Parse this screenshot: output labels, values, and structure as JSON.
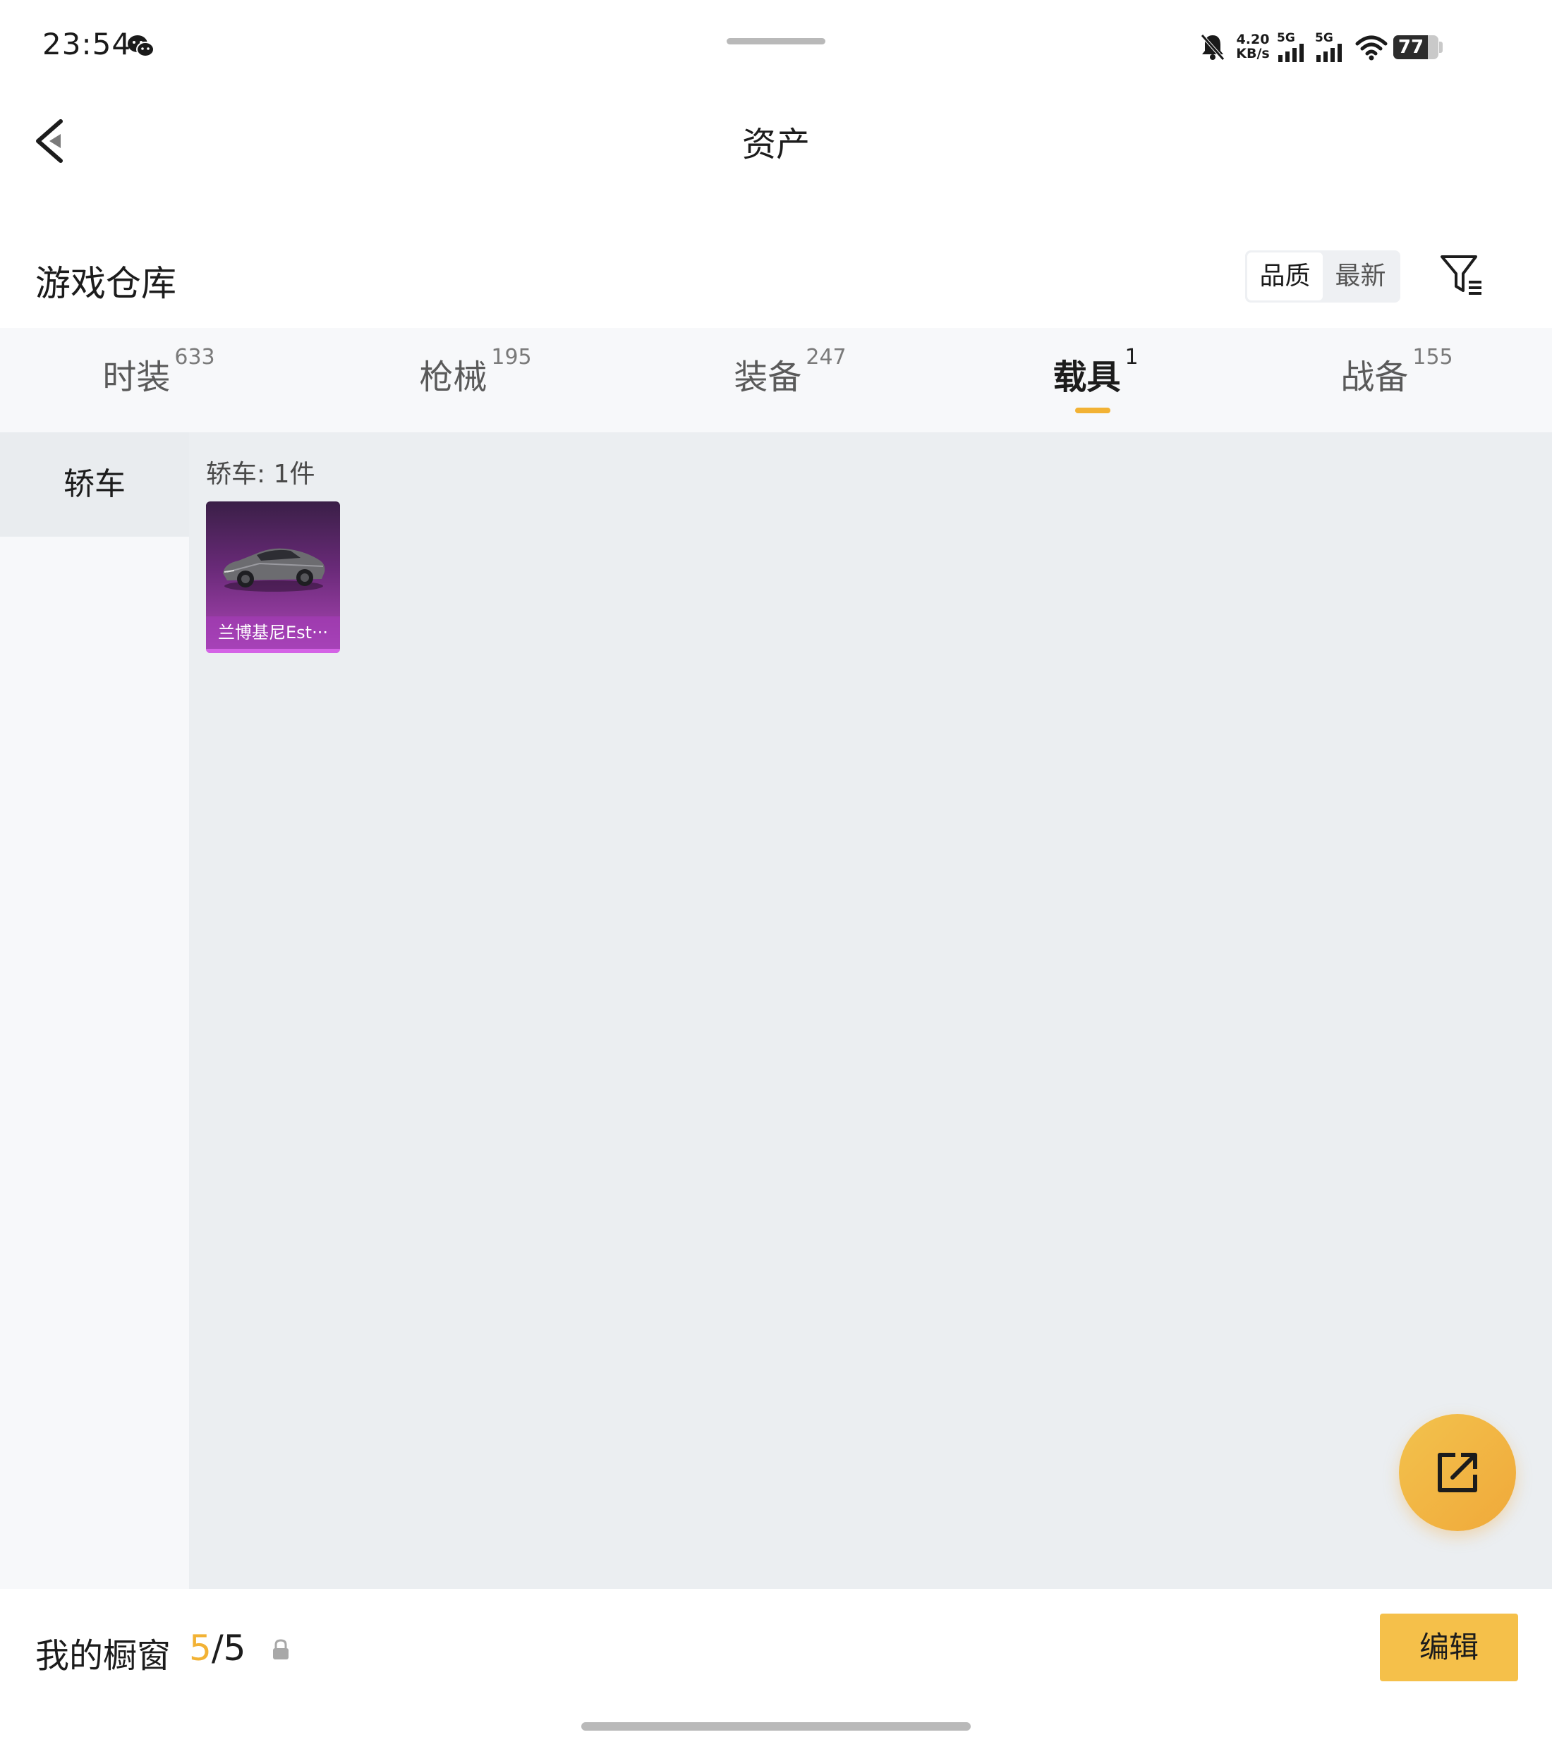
{
  "status_bar": {
    "time": "23:54",
    "net_speed_value": "4.20",
    "net_speed_unit": "KB/s",
    "signal1_label": "5G",
    "signal2_label": "5G",
    "battery_level": "77",
    "icons": [
      "wechat-icon",
      "bell-off-icon",
      "signal-icon",
      "wifi-icon",
      "battery-icon"
    ]
  },
  "nav": {
    "title": "资产",
    "back_icon": "chevron-left-icon"
  },
  "warehouse": {
    "title": "游戏仓库",
    "sort_options": [
      "品质",
      "最新"
    ],
    "active_sort": "品质",
    "filter_icon": "filter-icon"
  },
  "tabs": [
    {
      "label": "时装",
      "count": "633"
    },
    {
      "label": "枪械",
      "count": "195"
    },
    {
      "label": "装备",
      "count": "247"
    },
    {
      "label": "载具",
      "count": "1"
    },
    {
      "label": "战备",
      "count": "155"
    }
  ],
  "active_tab": "载具",
  "categories": [
    {
      "label": "轿车"
    }
  ],
  "group": {
    "label": "轿车: 1件",
    "items": [
      {
        "name": "兰博基尼Est···",
        "rarity_color": "#a54bb3"
      }
    ]
  },
  "fab": {
    "icon": "external-link-icon"
  },
  "showcase": {
    "label": "我的橱窗",
    "current": "5",
    "separator": "/",
    "max": "5",
    "lock_icon": "lock-icon",
    "edit_label": "编辑"
  },
  "colors": {
    "accent": "#f2b234",
    "button": "#f5c04a",
    "tab_bg": "#f7f8fa",
    "content_bg": "#ebeef1"
  }
}
